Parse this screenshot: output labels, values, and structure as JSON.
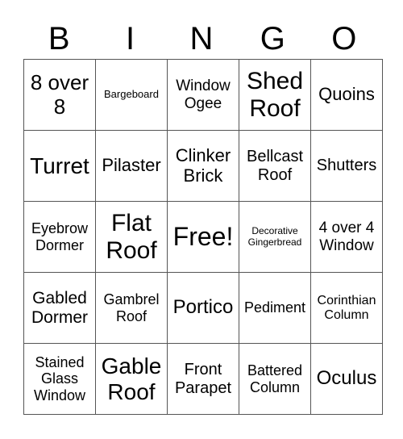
{
  "header": [
    "B",
    "I",
    "N",
    "G",
    "O"
  ],
  "rows": [
    [
      {
        "text": "8 over 8",
        "size": 26
      },
      {
        "text": "Bargeboard",
        "size": 13
      },
      {
        "text": "Window Ogee",
        "size": 19
      },
      {
        "text": "Shed Roof",
        "size": 30
      },
      {
        "text": "Quoins",
        "size": 22
      }
    ],
    [
      {
        "text": "Turret",
        "size": 28
      },
      {
        "text": "Pilaster",
        "size": 22
      },
      {
        "text": "Clinker Brick",
        "size": 22
      },
      {
        "text": "Bellcast Roof",
        "size": 20
      },
      {
        "text": "Shutters",
        "size": 20
      }
    ],
    [
      {
        "text": "Eyebrow Dormer",
        "size": 18
      },
      {
        "text": "Flat Roof",
        "size": 30
      },
      {
        "text": "Free!",
        "size": 32
      },
      {
        "text": "Decorative Gingerbread",
        "size": 12
      },
      {
        "text": "4 over 4 Window",
        "size": 19
      }
    ],
    [
      {
        "text": "Gabled Dormer",
        "size": 21
      },
      {
        "text": "Gambrel Roof",
        "size": 18
      },
      {
        "text": "Portico",
        "size": 24
      },
      {
        "text": "Pediment",
        "size": 18
      },
      {
        "text": "Corinthian Column",
        "size": 16
      }
    ],
    [
      {
        "text": "Stained Glass Window",
        "size": 18
      },
      {
        "text": "Gable Roof",
        "size": 28
      },
      {
        "text": "Front Parapet",
        "size": 20
      },
      {
        "text": "Battered Column",
        "size": 18
      },
      {
        "text": "Oculus",
        "size": 24
      }
    ]
  ]
}
